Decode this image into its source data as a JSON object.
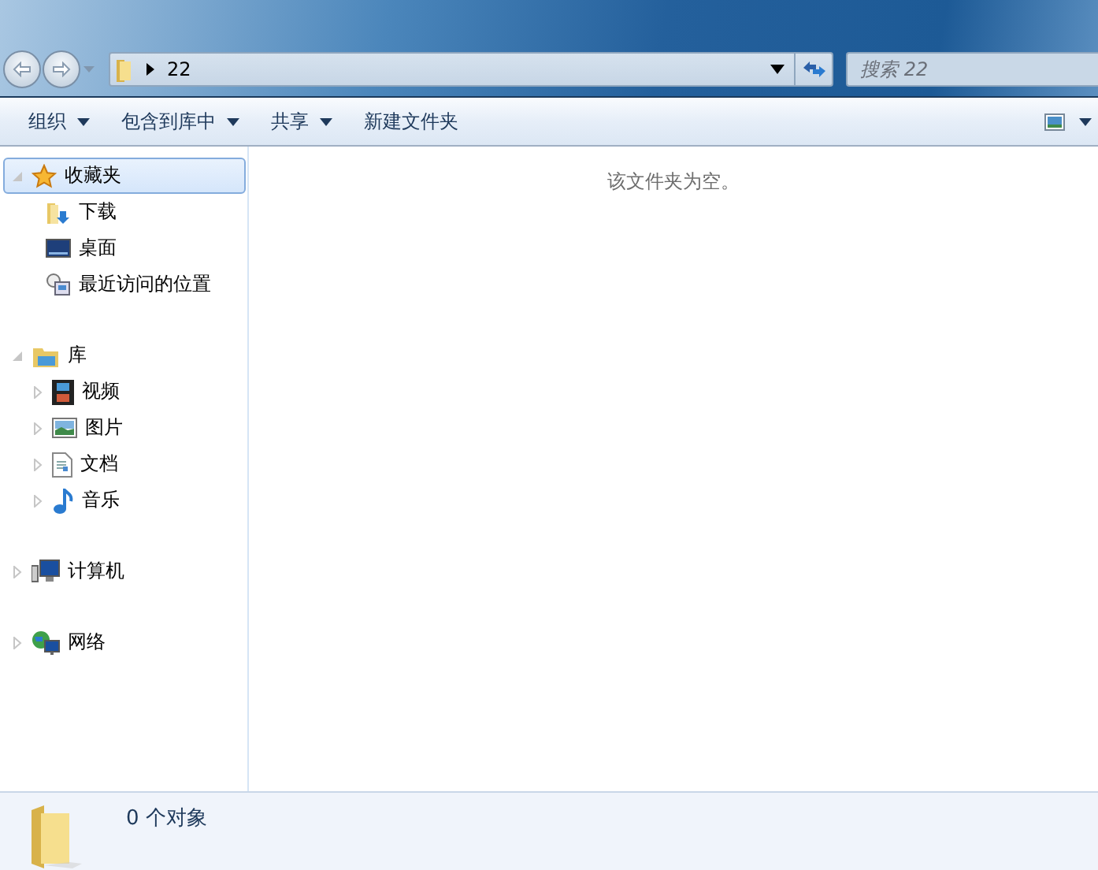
{
  "address": {
    "path": "22",
    "search_placeholder": "搜索 22"
  },
  "toolbar": [
    {
      "label": "组织",
      "has_menu": true
    },
    {
      "label": "包含到库中",
      "has_menu": true
    },
    {
      "label": "共享",
      "has_menu": true
    },
    {
      "label": "新建文件夹",
      "has_menu": false
    }
  ],
  "sidebar": {
    "groups": [
      {
        "label": "收藏夹",
        "kind": "star",
        "expanded": true,
        "selected": true,
        "children": [
          {
            "label": "下载",
            "kind": "download",
            "selected": false
          },
          {
            "label": "桌面",
            "kind": "desktop",
            "selected": false
          },
          {
            "label": "最近访问的位置",
            "kind": "recent",
            "selected": false
          }
        ]
      },
      {
        "label": "库",
        "kind": "library",
        "expanded": true,
        "selected": false,
        "children": [
          {
            "label": "视频",
            "kind": "video",
            "expanded": false,
            "selected": false
          },
          {
            "label": "图片",
            "kind": "picture",
            "expanded": false,
            "selected": false
          },
          {
            "label": "文档",
            "kind": "document",
            "expanded": false,
            "selected": false
          },
          {
            "label": "音乐",
            "kind": "music",
            "expanded": false,
            "selected": false
          }
        ]
      },
      {
        "label": "计算机",
        "kind": "computer",
        "expanded": false,
        "selected": false
      },
      {
        "label": "网络",
        "kind": "network",
        "expanded": false,
        "selected": false
      }
    ]
  },
  "content": {
    "empty_message": "该文件夹为空。"
  },
  "status_bar": {
    "text": "0 个对象"
  }
}
